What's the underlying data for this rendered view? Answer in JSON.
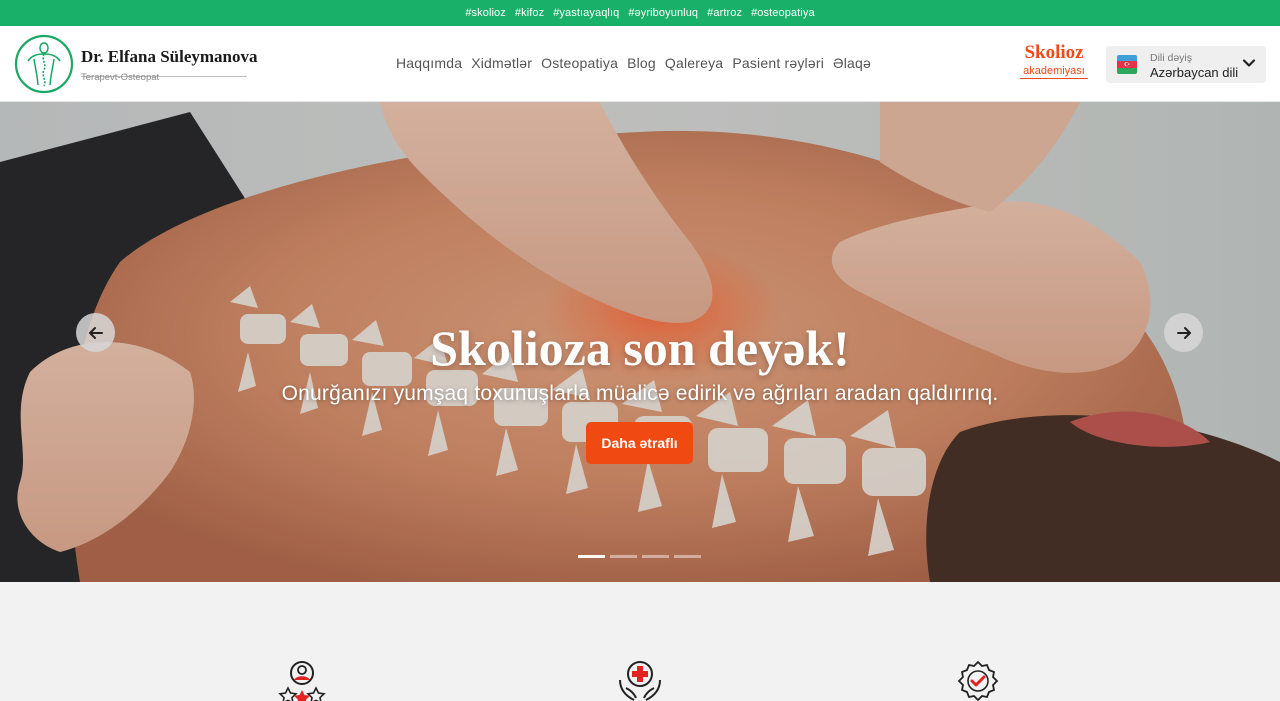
{
  "topbar": {
    "tags": [
      "#skolioz",
      "#kifoz",
      "#yastıayaqlıq",
      "#əyriboyunluq",
      "#artroz",
      "#osteopatiya"
    ]
  },
  "brand": {
    "name": "Dr. Elfana Süleymanova",
    "subtitle": "Terapevt-Osteopat"
  },
  "nav": {
    "items": [
      "Haqqımda",
      "Xidmətlər",
      "Osteopatiya",
      "Blog",
      "Qalereya",
      "Pasient rəyləri",
      "Əlaqə"
    ]
  },
  "academy": {
    "title": "Skolioz",
    "subtitle": "akademiyası"
  },
  "language": {
    "hint": "Dili dəyiş",
    "value": "Azərbaycan dili",
    "flag_colors": [
      "#3f9fd8",
      "#e8324a",
      "#2da85a"
    ]
  },
  "hero": {
    "title": "Skolioza son deyək!",
    "subtitle": "Onurğanızı yumşaq toxunuşlarla müalicə edirik və ağrıları aradan qaldırırıq.",
    "button_label": "Daha ətraflı",
    "slides_total": 4,
    "active_slide": 1
  },
  "colors": {
    "brand_green": "#19b06a",
    "accent_orange": "#f04a12"
  },
  "features": {
    "icons": [
      "specialist-rating-icon",
      "medical-care-hands-icon",
      "quality-badge-icon"
    ]
  }
}
